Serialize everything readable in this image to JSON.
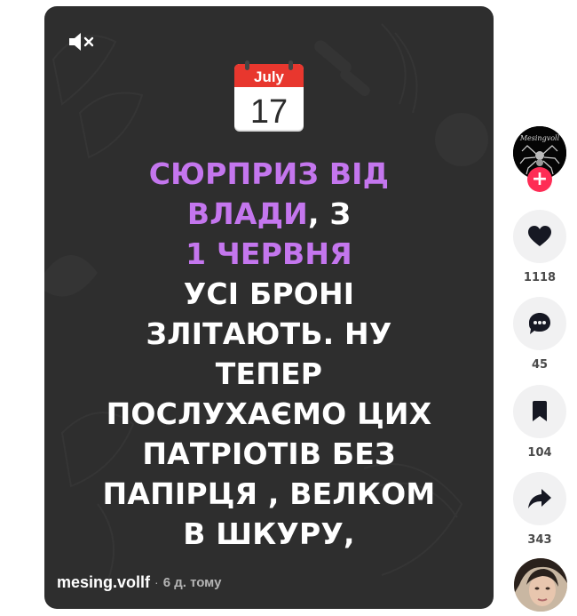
{
  "video": {
    "caption": {
      "line1": "СЮРПРИЗ ВІД",
      "line2_purple": "ВЛАДИ",
      "line2_rest": ", З",
      "line3": "1 ЧЕРВНЯ",
      "line4": "УСІ БРОНІ",
      "line5": "ЗЛІТАЮТЬ. НУ",
      "line6": "ТЕПЕР",
      "line7": "ПОСЛУХАЄМО ЦИХ",
      "line8": "ПАТРІОТІВ БЕЗ",
      "line9": "ПАПІРЦЯ , ВЕЛКОМ",
      "line10": "В ШКУРУ,"
    },
    "calendar": {
      "month": "July",
      "day": "17"
    },
    "author": "mesing.vollf",
    "separator": "·",
    "time": "6 д. тому",
    "mute_icon": "muted-speaker-icon"
  },
  "rail": {
    "follow_label": "+",
    "likes": "1118",
    "comments": "45",
    "saves": "104",
    "shares": "343"
  },
  "colors": {
    "accent_purple": "#c476ee",
    "follow_red": "#fe2c55",
    "video_bg": "#2e2e2e"
  }
}
